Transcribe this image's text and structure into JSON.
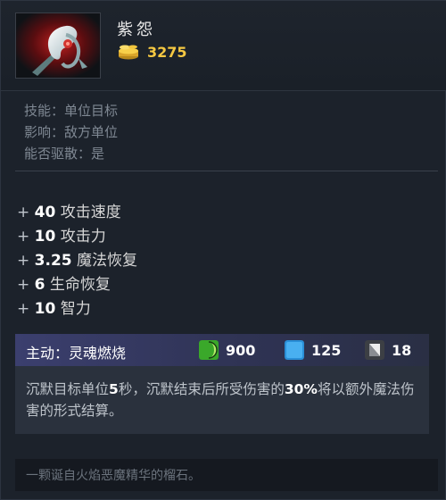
{
  "item": {
    "name": "紫怨",
    "cost": "3275",
    "icon": "orchid-item-icon"
  },
  "ability_info": {
    "lines": [
      "技能：单位目标",
      "影响：敌方单位",
      "能否驱散：是"
    ]
  },
  "stats": [
    {
      "value": "40",
      "label": "攻击速度"
    },
    {
      "value": "10",
      "label": "攻击力"
    },
    {
      "value": "3.25",
      "label": "魔法恢复"
    },
    {
      "value": "6",
      "label": "生命恢复"
    },
    {
      "value": "10",
      "label": "智力"
    }
  ],
  "active": {
    "title": "主动：灵魂燃烧",
    "cooldown": "900",
    "cooldown_icon": "green-cooldown-icon",
    "mana": "125",
    "mana_icon": "blue-mana-icon",
    "charge": "18",
    "charge_icon": "white-cost-icon",
    "desc_part1": "沉默目标单位",
    "desc_bold1": "5",
    "desc_part2": "秒，沉默结束后所受伤害的",
    "desc_bold2": "30%",
    "desc_part3": "将以额外魔法伤害的形式结算。"
  },
  "lore": "一颗诞自火焰恶魔精华的榴石。",
  "colors": {
    "gold": "#f5c842",
    "background": "#1c222b",
    "active_header": "#3b3f6e"
  }
}
